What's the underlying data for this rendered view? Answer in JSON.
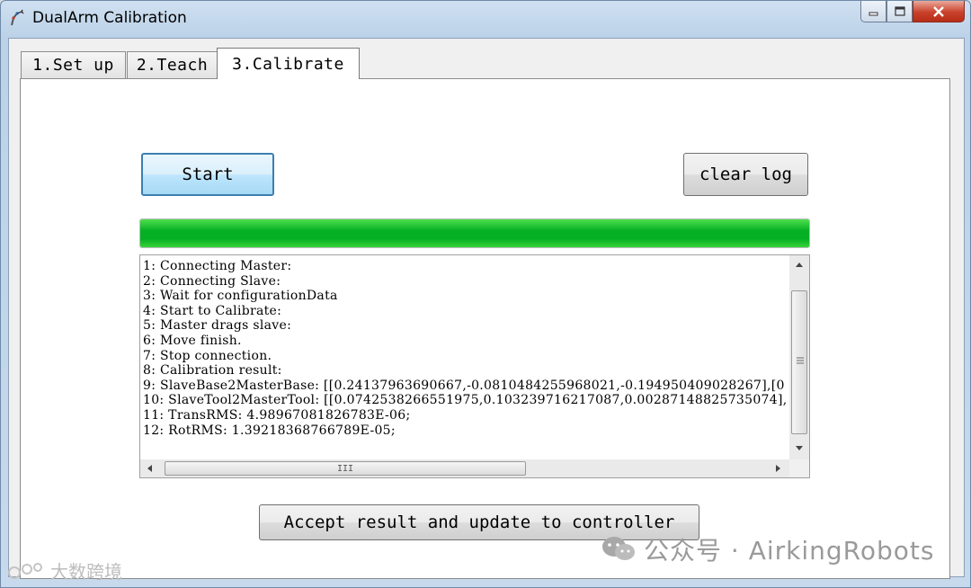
{
  "window": {
    "title": "DualArm Calibration"
  },
  "tabs": [
    {
      "label": "1.Set up",
      "active": false
    },
    {
      "label": "2.Teach",
      "active": false
    },
    {
      "label": "3.Calibrate",
      "active": true
    }
  ],
  "calibrate": {
    "start_label": "Start",
    "clear_log_label": "clear log",
    "progress_fraction": 1.0,
    "progress_color": "#06b025",
    "log_lines": [
      "1: Connecting Master:",
      "2: Connecting Slave:",
      "3: Wait for configurationData",
      "4: Start to Calibrate:",
      "5: Master drags slave:",
      "6: Move finish.",
      "7: Stop connection.",
      "8: Calibration result:",
      "9: SlaveBase2MasterBase: [[0.24137963690667,-0.0810484255968021,-0.194950409028267],[0",
      "10: SlaveTool2MasterTool: [[0.0742538266551975,0.103239716217087,0.00287148825735074],",
      "11: TransRMS: 4.98967081826783E-06;",
      "12: RotRMS: 1.39218368766789E-05;"
    ],
    "hscroll_thumb_label": "III",
    "accept_label": "Accept result and update to controller"
  },
  "watermarks": {
    "right": "公众号 · AirkingRobots",
    "left": "大数跨境"
  },
  "icons": {
    "app": "robot-arm-icon",
    "minimize": "minimize-icon",
    "maximize": "maximize-icon",
    "close": "close-icon"
  }
}
